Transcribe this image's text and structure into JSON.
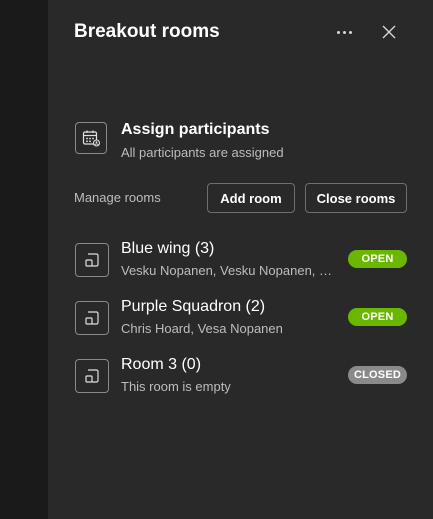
{
  "panel": {
    "title": "Breakout rooms",
    "more_icon": "more-horizontal-icon",
    "close_icon": "close-icon"
  },
  "assign": {
    "title": "Assign participants",
    "subtitle": "All participants are assigned",
    "icon": "assign-calendar-icon"
  },
  "manage": {
    "label": "Manage rooms",
    "add_room": "Add room",
    "close_rooms": "Close rooms"
  },
  "rooms": [
    {
      "name": "Blue wing (3)",
      "members": "Vesku Nopanen, Vesku Nopanen, Chris Hoard",
      "status": "OPEN"
    },
    {
      "name": "Purple Squadron (2)",
      "members": "Chris Hoard, Vesa Nopanen",
      "status": "OPEN"
    },
    {
      "name": "Room 3 (0)",
      "members": "This room is empty",
      "status": "CLOSED"
    }
  ],
  "colors": {
    "open": "#6bb700",
    "closed": "#8a8a8a",
    "panel_bg": "#292929"
  }
}
